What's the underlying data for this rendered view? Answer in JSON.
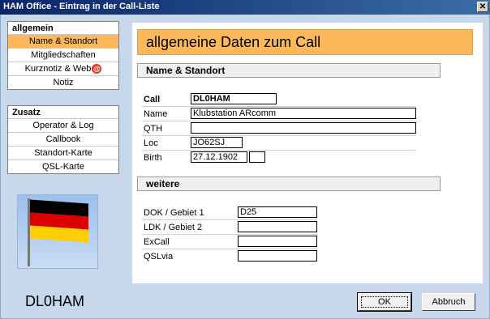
{
  "window": {
    "title": "HAM Office - Eintrag in der Call-Liste",
    "close": "✕"
  },
  "nav_allgemein": {
    "head": "allgemein",
    "items": [
      "Name & Standort",
      "Mitgliedschaften",
      "Kurznotiz & Web",
      "Notiz"
    ],
    "at": "@"
  },
  "nav_zusatz": {
    "head": "Zusatz",
    "items": [
      "Operator & Log",
      "Callbook",
      "Standort-Karte",
      "QSL-Karte"
    ]
  },
  "flag_colors": [
    "#000000",
    "#dd0000",
    "#ffce00"
  ],
  "callsign_display": "DL0HAM",
  "header": "allgemeine Daten zum Call",
  "section_name": "Name & Standort",
  "section_weitere": "weitere",
  "labels": {
    "call": "Call",
    "name": "Name",
    "qth": "QTH",
    "loc": "Loc",
    "birth": "Birth",
    "dok": "DOK / Gebiet 1",
    "ldk": "LDK / Gebiet 2",
    "excall": "ExCall",
    "qslvia": "QSLvia"
  },
  "values": {
    "call": "DL0HAM",
    "name": "Klubstation ARcomm",
    "qth": "",
    "loc": "JO62SJ",
    "birth": "27.12.1902",
    "birth_extra": "",
    "dok": "D25",
    "ldk": "",
    "excall": "",
    "qslvia": ""
  },
  "buttons": {
    "ok": "OK",
    "cancel": "Abbruch"
  }
}
